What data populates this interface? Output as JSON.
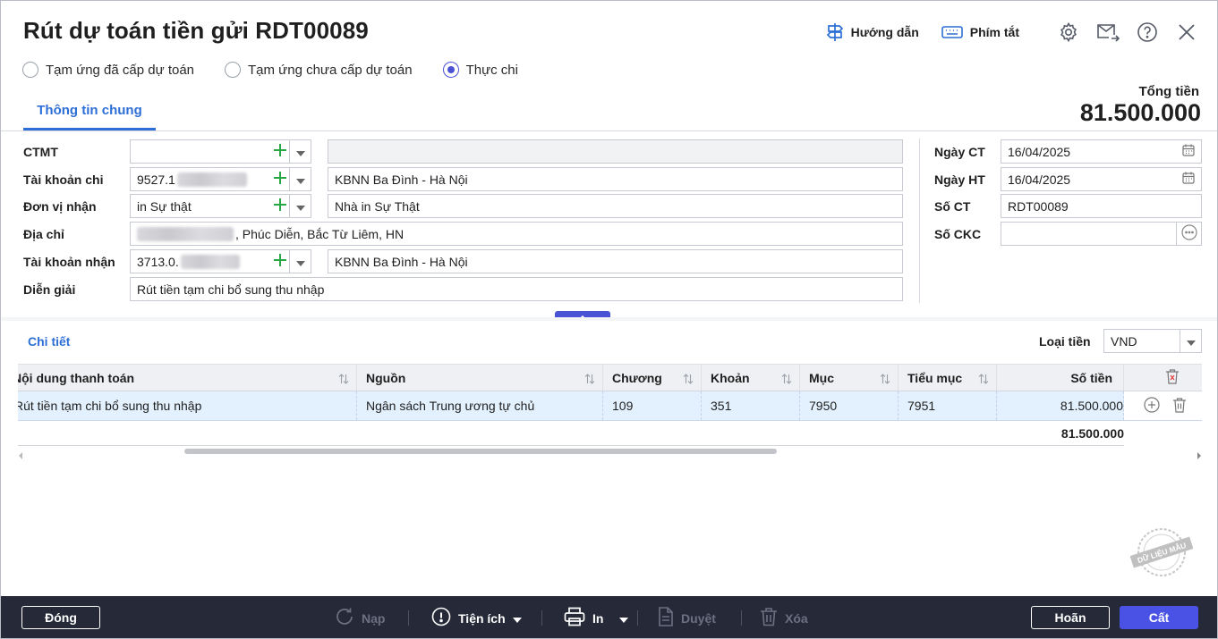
{
  "window": {
    "title": "Rút dự toán tiền gửi RDT00089",
    "tools": {
      "guide": "Hướng dẫn",
      "shortcuts": "Phím tắt"
    }
  },
  "payment_type": {
    "options": [
      "Tạm ứng đã cấp dự toán",
      "Tạm ứng chưa cấp dự toán",
      "Thực chi"
    ],
    "selected": "Thực chi"
  },
  "tabs": {
    "general": "Thông tin chung"
  },
  "total": {
    "label": "Tổng tiền",
    "value": "81.500.000"
  },
  "form": {
    "ctmt": {
      "label": "CTMT",
      "value": "",
      "description": ""
    },
    "spend_account": {
      "label": "Tài khoản chi",
      "value": "9527.1",
      "description": "KBNN Ba Đình - Hà Nội"
    },
    "recipient": {
      "label": "Đơn vị nhận",
      "value": "in Sự thật",
      "description": "Nhà in Sự Thật"
    },
    "address": {
      "label": "Địa chỉ",
      "value": ", Phúc Diễn, Bắc Từ Liêm, HN"
    },
    "receive_account": {
      "label": "Tài khoản nhận",
      "value": "3713.0.",
      "description": "KBNN Ba Đình - Hà Nội"
    },
    "explanation": {
      "label": "Diễn giải",
      "value": "Rút tiền tạm chi bổ sung thu nhập"
    }
  },
  "doc_info": {
    "voucher_date": {
      "label": "Ngày CT",
      "value": "16/04/2025"
    },
    "posting_date": {
      "label": "Ngày HT",
      "value": "16/04/2025"
    },
    "voucher_no": {
      "label": "Số CT",
      "value": "RDT00089"
    },
    "transfer_no": {
      "label": "Số CKC",
      "value": ""
    }
  },
  "detail": {
    "title": "Chi tiết",
    "currency_label": "Loại tiền",
    "currency_value": "VND",
    "columns": [
      "Nội dung thanh toán",
      "Nguồn",
      "Chương",
      "Khoản",
      "Mục",
      "Tiểu mục",
      "Số tiền"
    ],
    "rows": [
      {
        "content": "Rút tiền tạm chi bổ sung thu nhập",
        "source": "Ngân sách Trung ương tự chủ",
        "chapter": "109",
        "section": "351",
        "item": "7950",
        "subitem": "7951",
        "amount": "81.500.000"
      }
    ],
    "footer_total": "81.500.000"
  },
  "watermark": "DỮ LIỆU MẪU",
  "footer": {
    "close": "Đóng",
    "load": "Nạp",
    "utilities": "Tiện ích",
    "print": "In",
    "approve": "Duyệt",
    "delete": "Xóa",
    "undo": "Hoãn",
    "save": "Cất"
  },
  "colors": {
    "accent": "#4a52e6",
    "link": "#2d6fd6",
    "footer_bg": "#262a38",
    "row_selected": "#e3f0fd"
  }
}
